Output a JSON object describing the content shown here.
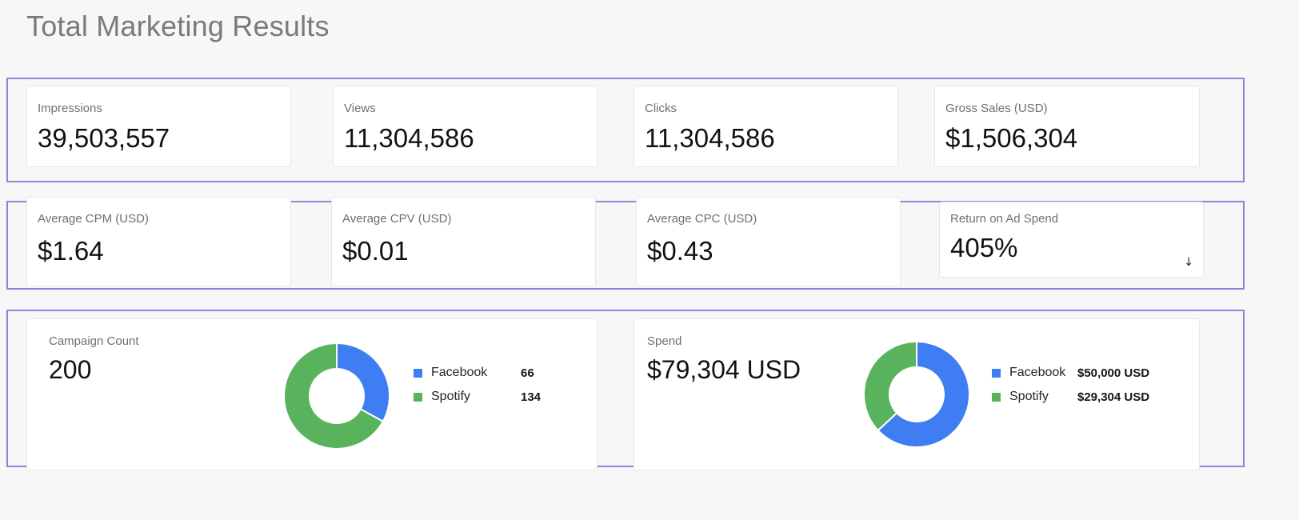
{
  "page": {
    "title": "Total Marketing Results"
  },
  "colors": {
    "facebook": "#3f7df2",
    "spotify": "#59b35d",
    "outline": "#8b84d7"
  },
  "row1": [
    {
      "label": "Impressions",
      "value": "39,503,557"
    },
    {
      "label": "Views",
      "value": "11,304,586"
    },
    {
      "label": "Clicks",
      "value": "11,304,586"
    },
    {
      "label": "Gross Sales (USD)",
      "value": "$1,506,304"
    }
  ],
  "row2": [
    {
      "label": "Average CPM (USD)",
      "value": "$1.64"
    },
    {
      "label": "Average CPV (USD)",
      "value": "$0.01"
    },
    {
      "label": "Average CPC (USD)",
      "value": "$0.43"
    },
    {
      "label": "Return on Ad Spend",
      "value": "405%",
      "icon": "arrow-down-icon"
    }
  ],
  "campaign": {
    "label": "Campaign Count",
    "value": "200",
    "legend": [
      {
        "name": "Facebook",
        "value": "66"
      },
      {
        "name": "Spotify",
        "value": "134"
      }
    ]
  },
  "spend": {
    "label": "Spend",
    "value": "$79,304 USD",
    "legend": [
      {
        "name": "Facebook",
        "value": "$50,000 USD"
      },
      {
        "name": "Spotify",
        "value": "$29,304 USD"
      }
    ]
  },
  "chart_data": [
    {
      "type": "pie",
      "categories": [
        "Facebook",
        "Spotify"
      ],
      "values": [
        66,
        134
      ]
    },
    {
      "type": "pie",
      "categories": [
        "Facebook",
        "Spotify"
      ],
      "values": [
        50000,
        29304
      ]
    }
  ]
}
